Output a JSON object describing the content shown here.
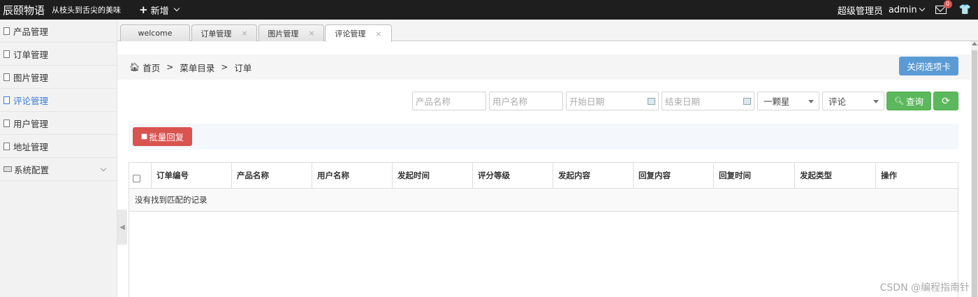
{
  "topbar": {
    "brand": "辰颐物语",
    "slogan": "从枝头到舌尖的美味",
    "new_label": "新增",
    "role": "超级管理员",
    "username": "admin",
    "mail_badge": "0"
  },
  "sidebar": {
    "items": [
      {
        "label": "产品管理"
      },
      {
        "label": "订单管理"
      },
      {
        "label": "图片管理"
      },
      {
        "label": "评论管理"
      },
      {
        "label": "用户管理"
      },
      {
        "label": "地址管理"
      },
      {
        "label": "系统配置"
      }
    ],
    "active": "评论管理"
  },
  "tabs": [
    {
      "label": "welcome"
    },
    {
      "label": "订单管理"
    },
    {
      "label": "图片管理"
    },
    {
      "label": "评论管理"
    }
  ],
  "breadcrumb": {
    "home": "首页",
    "level1": "菜单目录",
    "level2": "订单",
    "separator": ">"
  },
  "close_tabs_label": "关闭选项卡",
  "filters": {
    "product_placeholder": "产品名称",
    "user_placeholder": "用户名称",
    "start_date_placeholder": "开始日期",
    "end_date_placeholder": "结束日期",
    "rating_value": "一颗星",
    "type_value": "评论",
    "search_label": "查询"
  },
  "batch_reply_label": "批量回复",
  "table": {
    "columns": [
      "订单编号",
      "产品名称",
      "用户名称",
      "发起时间",
      "评分等级",
      "发起内容",
      "回复内容",
      "回复时间",
      "发起类型",
      "操作"
    ],
    "empty_message": "没有找到匹配的记录"
  },
  "watermark": "CSDN @编程指南针",
  "colors": {
    "topbar": "#1e1e1e",
    "primary": "#5b9bd5",
    "success": "#5cb85c",
    "danger": "#d9534f",
    "active_link": "#3a7bd5"
  }
}
